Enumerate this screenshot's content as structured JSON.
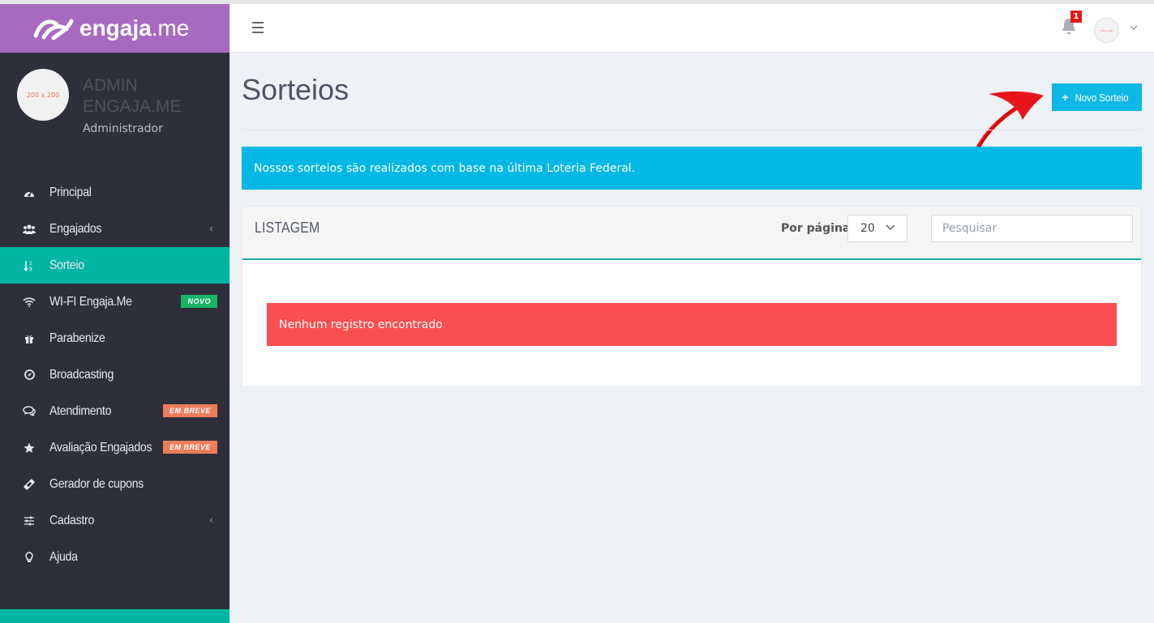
{
  "brand": {
    "name_bold": "engaja",
    "name_tld": ".me"
  },
  "profile": {
    "avatar_text": "200 x 200",
    "name": "ADMIN ENGAJA.ME",
    "role": "Administrador"
  },
  "sidebar": {
    "items": [
      {
        "label": "Principal",
        "icon": "dashboard-icon"
      },
      {
        "label": "Engajados",
        "icon": "users-icon",
        "chevron": "‹"
      },
      {
        "label": "Sorteio",
        "icon": "sort-numeric-icon"
      },
      {
        "label": "WI-FI Engaja.Me",
        "icon": "wifi-icon",
        "badge": "NOVO"
      },
      {
        "label": "Parabenize",
        "icon": "gift-icon"
      },
      {
        "label": "Broadcasting",
        "icon": "compass-icon"
      },
      {
        "label": "Atendimento",
        "icon": "chat-icon",
        "badge": "EM BREVE"
      },
      {
        "label": "Avaliação Engajados",
        "icon": "star-icon",
        "badge": "EM BREVE"
      },
      {
        "label": "Gerador de cupons",
        "icon": "ticket-icon"
      },
      {
        "label": "Cadastro",
        "icon": "sliders-icon",
        "chevron": "‹"
      },
      {
        "label": "Ajuda",
        "icon": "lightbulb-icon"
      }
    ]
  },
  "header": {
    "notification_count": "1",
    "user_avatar_text": "200 x 200"
  },
  "page": {
    "title": "Sorteios",
    "new_button_label": "Novo Sorteio",
    "info_message": "Nossos sorteios são realizados com base na última Loteria Federal."
  },
  "listing": {
    "title": "LISTAGEM",
    "per_page_label": "Por página:",
    "per_page_value": "20",
    "search_placeholder": "Pesquisar",
    "empty_message": "Nenhum registro encontrado"
  },
  "colors": {
    "sidebar_bg": "#2d2f3a",
    "brand_bar": "#a66bbe",
    "active_item": "#00b5a3",
    "info_alert": "#00b7e6",
    "danger_alert": "#fb4e51",
    "primary_button": "#0fb8e4"
  }
}
